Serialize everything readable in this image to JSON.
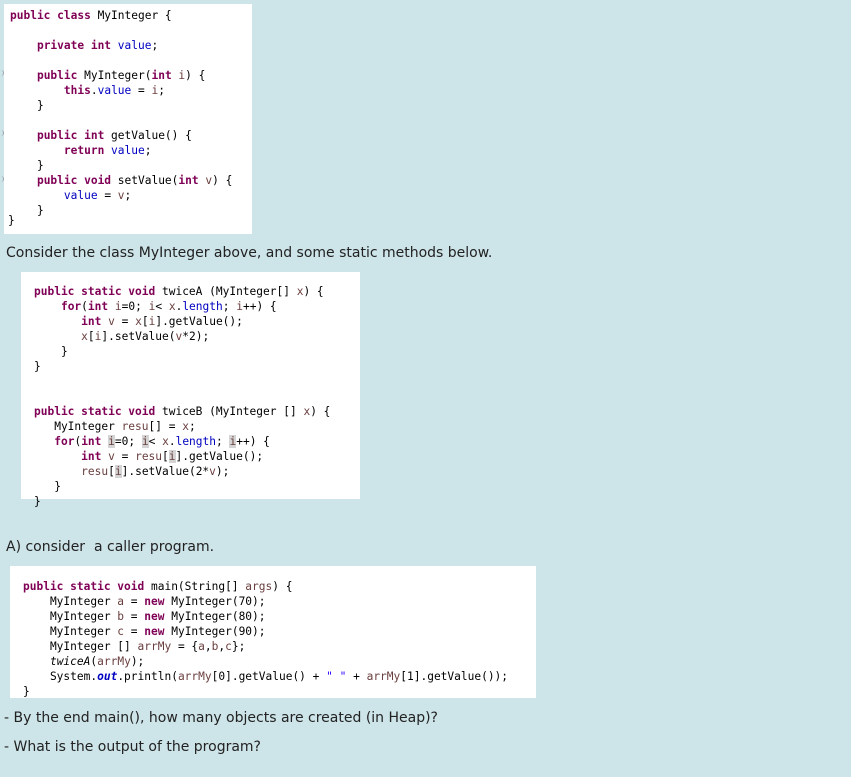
{
  "class_code": {
    "lines": [
      [
        {
          "t": "public class ",
          "c": "kw"
        },
        {
          "t": "MyInteger {"
        }
      ],
      [],
      [
        {
          "t": "    "
        },
        {
          "t": "private int ",
          "c": "kw"
        },
        {
          "t": "value",
          "c": "fld"
        },
        {
          "t": ";"
        }
      ],
      [],
      [
        {
          "t": "    "
        },
        {
          "t": "public ",
          "c": "kw"
        },
        {
          "t": "MyInteger("
        },
        {
          "t": "int ",
          "c": "kw"
        },
        {
          "t": "i",
          "c": "par"
        },
        {
          "t": ") {"
        }
      ],
      [
        {
          "t": "        "
        },
        {
          "t": "this",
          "c": "kw"
        },
        {
          "t": "."
        },
        {
          "t": "value",
          "c": "fld"
        },
        {
          "t": " = "
        },
        {
          "t": "i",
          "c": "par"
        },
        {
          "t": ";"
        }
      ],
      [
        {
          "t": "    }"
        }
      ],
      [],
      [
        {
          "t": "    "
        },
        {
          "t": "public int ",
          "c": "kw"
        },
        {
          "t": "getValue() {"
        }
      ],
      [
        {
          "t": "        "
        },
        {
          "t": "return ",
          "c": "kw"
        },
        {
          "t": "value",
          "c": "fld"
        },
        {
          "t": ";"
        }
      ],
      [
        {
          "t": "    }"
        }
      ],
      [
        {
          "t": "    "
        },
        {
          "t": "public void ",
          "c": "kw"
        },
        {
          "t": "setValue("
        },
        {
          "t": "int ",
          "c": "kw"
        },
        {
          "t": "v",
          "c": "par"
        },
        {
          "t": ") {"
        }
      ],
      [
        {
          "t": "        "
        },
        {
          "t": "value",
          "c": "fld"
        },
        {
          "t": " = "
        },
        {
          "t": "v",
          "c": "par"
        },
        {
          "t": ";"
        }
      ],
      [
        {
          "t": "    }"
        }
      ]
    ]
  },
  "closing_brace": "}",
  "text_intro": "Consider the class MyInteger above, and some static methods below.",
  "methods_code": {
    "lines": [
      [
        {
          "t": "public static void ",
          "c": "kw"
        },
        {
          "t": "twiceA (MyInteger[] "
        },
        {
          "t": "x",
          "c": "par"
        },
        {
          "t": ") {"
        }
      ],
      [
        {
          "t": "    "
        },
        {
          "t": "for",
          "c": "kw"
        },
        {
          "t": "("
        },
        {
          "t": "int ",
          "c": "kw"
        },
        {
          "t": "i",
          "c": "par"
        },
        {
          "t": "=0; "
        },
        {
          "t": "i",
          "c": "par"
        },
        {
          "t": "< "
        },
        {
          "t": "x",
          "c": "par"
        },
        {
          "t": "."
        },
        {
          "t": "length",
          "c": "fld"
        },
        {
          "t": "; "
        },
        {
          "t": "i",
          "c": "par"
        },
        {
          "t": "++) {"
        }
      ],
      [
        {
          "t": "       "
        },
        {
          "t": "int ",
          "c": "kw"
        },
        {
          "t": "v",
          "c": "par"
        },
        {
          "t": " = "
        },
        {
          "t": "x",
          "c": "par"
        },
        {
          "t": "["
        },
        {
          "t": "i",
          "c": "par"
        },
        {
          "t": "].getValue();"
        }
      ],
      [
        {
          "t": "       "
        },
        {
          "t": "x",
          "c": "par"
        },
        {
          "t": "["
        },
        {
          "t": "i",
          "c": "par"
        },
        {
          "t": "].setValue("
        },
        {
          "t": "v",
          "c": "par"
        },
        {
          "t": "*2);"
        }
      ],
      [
        {
          "t": "    }"
        }
      ],
      [
        {
          "t": "}"
        }
      ],
      [],
      [],
      [
        {
          "t": "public static void ",
          "c": "kw"
        },
        {
          "t": "twiceB (MyInteger [] "
        },
        {
          "t": "x",
          "c": "par"
        },
        {
          "t": ") {"
        }
      ],
      [
        {
          "t": "   MyInteger "
        },
        {
          "t": "resu",
          "c": "par"
        },
        {
          "t": "[] = "
        },
        {
          "t": "x",
          "c": "par"
        },
        {
          "t": ";"
        }
      ],
      [
        {
          "t": "   "
        },
        {
          "t": "for",
          "c": "kw"
        },
        {
          "t": "("
        },
        {
          "t": "int ",
          "c": "kw"
        },
        {
          "t": "i",
          "c": "par hl"
        },
        {
          "t": "=0; "
        },
        {
          "t": "i",
          "c": "par hl"
        },
        {
          "t": "< "
        },
        {
          "t": "x",
          "c": "par"
        },
        {
          "t": "."
        },
        {
          "t": "length",
          "c": "fld"
        },
        {
          "t": "; "
        },
        {
          "t": "i",
          "c": "par hl"
        },
        {
          "t": "++) {"
        }
      ],
      [
        {
          "t": "       "
        },
        {
          "t": "int ",
          "c": "kw"
        },
        {
          "t": "v",
          "c": "par"
        },
        {
          "t": " = "
        },
        {
          "t": "resu",
          "c": "par"
        },
        {
          "t": "["
        },
        {
          "t": "i",
          "c": "par hl"
        },
        {
          "t": "].getValue();"
        }
      ],
      [
        {
          "t": "       "
        },
        {
          "t": "resu",
          "c": "par"
        },
        {
          "t": "["
        },
        {
          "t": "i",
          "c": "par hl"
        },
        {
          "t": "].setValue(2*"
        },
        {
          "t": "v",
          "c": "par"
        },
        {
          "t": ");"
        }
      ],
      [
        {
          "t": "   }"
        }
      ],
      [
        {
          "t": "}"
        }
      ]
    ]
  },
  "text_caller": "A) consider  a caller program.",
  "main_code": {
    "lines": [
      [
        {
          "t": "public static void ",
          "c": "kw"
        },
        {
          "t": "main(String[] "
        },
        {
          "t": "args",
          "c": "par"
        },
        {
          "t": ") {"
        }
      ],
      [
        {
          "t": "    MyInteger "
        },
        {
          "t": "a",
          "c": "par"
        },
        {
          "t": " = "
        },
        {
          "t": "new ",
          "c": "kw"
        },
        {
          "t": "MyInteger(70);"
        }
      ],
      [
        {
          "t": "    MyInteger "
        },
        {
          "t": "b",
          "c": "par"
        },
        {
          "t": " = "
        },
        {
          "t": "new ",
          "c": "kw"
        },
        {
          "t": "MyInteger(80);"
        }
      ],
      [
        {
          "t": "    MyInteger "
        },
        {
          "t": "c",
          "c": "par"
        },
        {
          "t": " = "
        },
        {
          "t": "new ",
          "c": "kw"
        },
        {
          "t": "MyInteger(90);"
        }
      ],
      [
        {
          "t": "    MyInteger [] "
        },
        {
          "t": "arrMy",
          "c": "par"
        },
        {
          "t": " = {"
        },
        {
          "t": "a",
          "c": "par"
        },
        {
          "t": ","
        },
        {
          "t": "b",
          "c": "par"
        },
        {
          "t": ","
        },
        {
          "t": "c",
          "c": "par"
        },
        {
          "t": "};"
        }
      ],
      [
        {
          "t": "    "
        },
        {
          "t": "twiceA",
          "c": "smeth"
        },
        {
          "t": "("
        },
        {
          "t": "arrMy",
          "c": "par"
        },
        {
          "t": ");"
        }
      ],
      [
        {
          "t": "    System."
        },
        {
          "t": "out",
          "c": "sfld"
        },
        {
          "t": ".println("
        },
        {
          "t": "arrMy",
          "c": "par"
        },
        {
          "t": "[0].getValue() + "
        },
        {
          "t": "\" \"",
          "c": "str"
        },
        {
          "t": " + "
        },
        {
          "t": "arrMy",
          "c": "par"
        },
        {
          "t": "[1].getValue());"
        }
      ],
      [
        {
          "t": "}"
        }
      ]
    ]
  },
  "question_1": "- By the end main(), how many objects are created (in Heap)?",
  "question_2": "- What is the output of the program?"
}
